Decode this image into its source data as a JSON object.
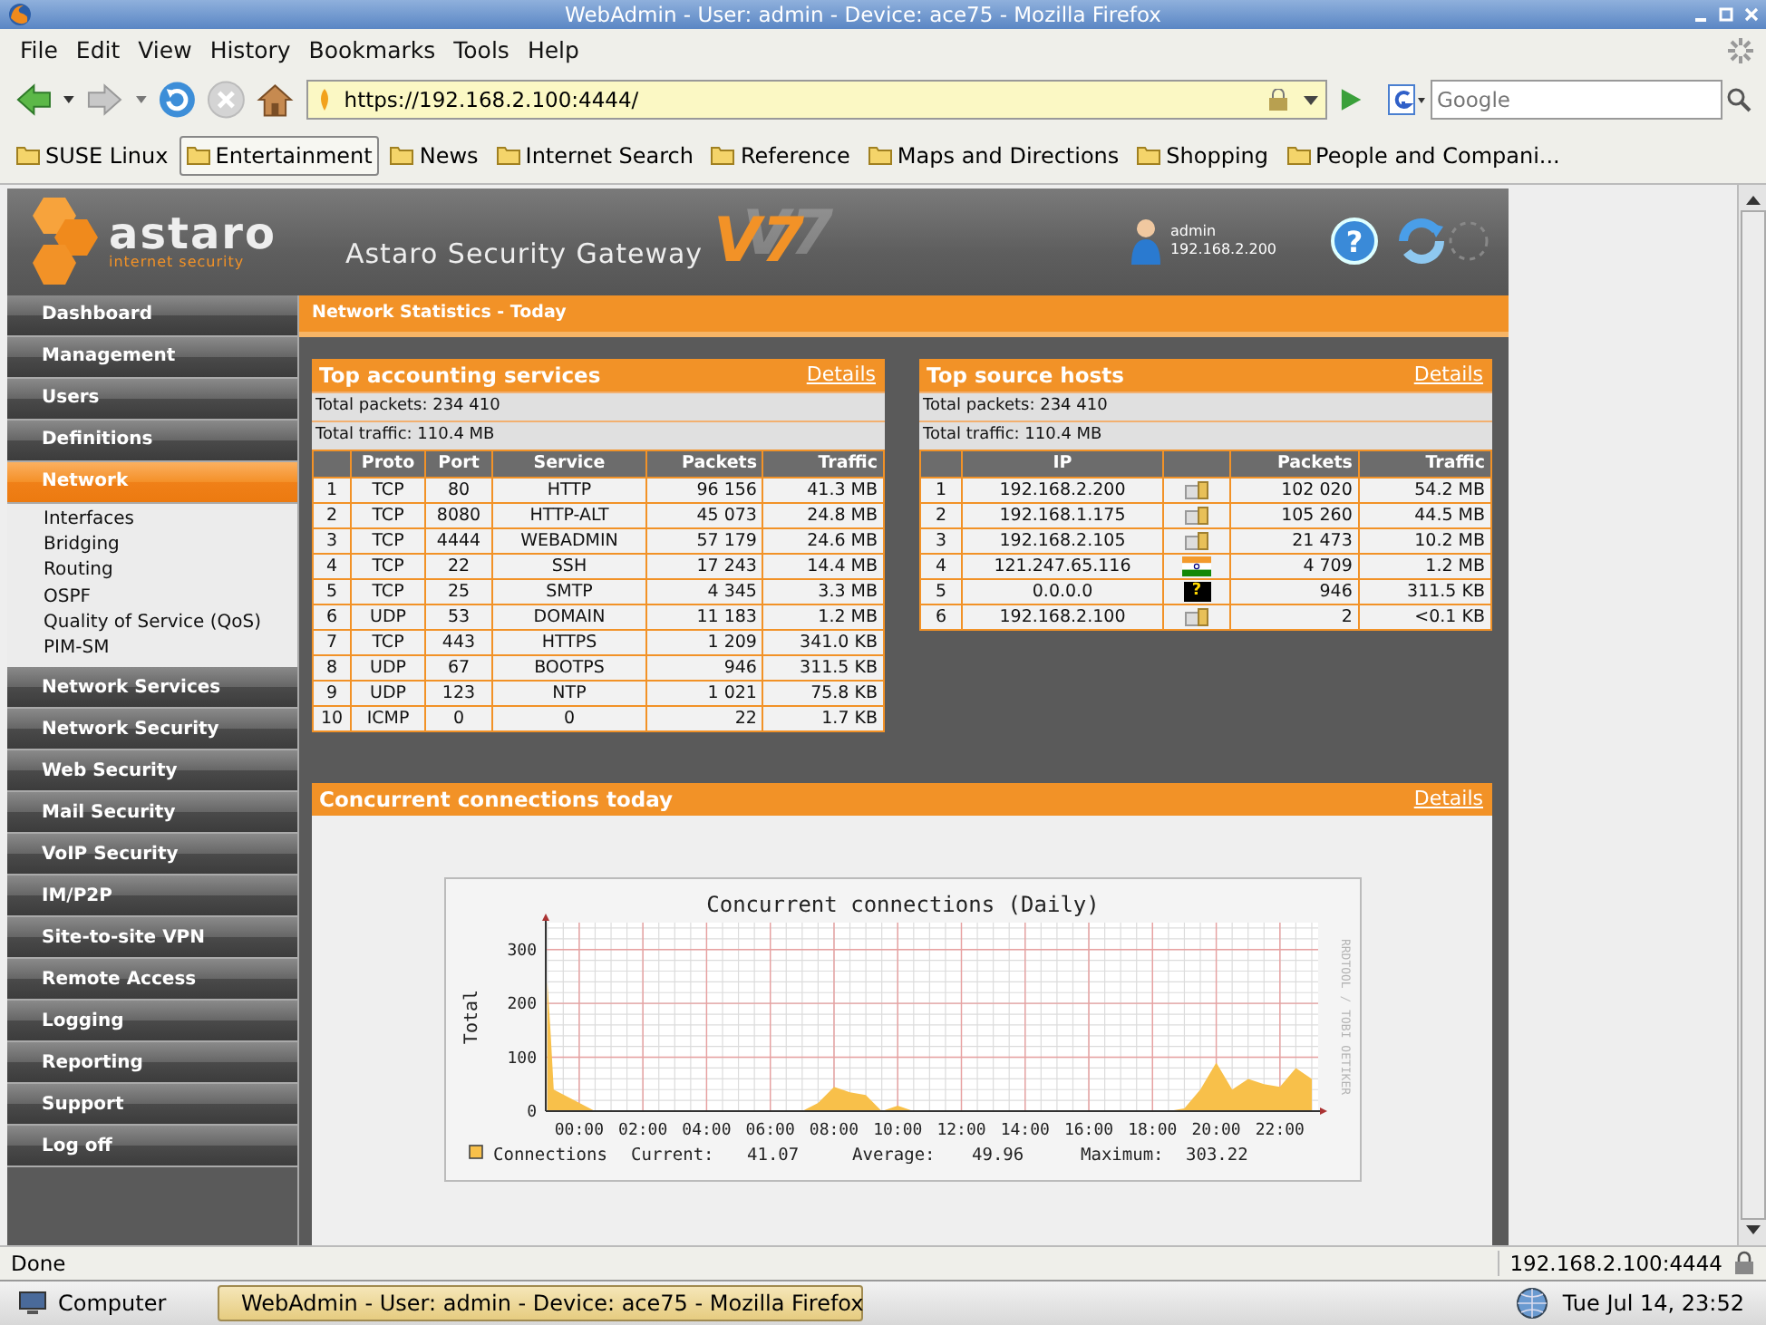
{
  "window": {
    "title": "WebAdmin - User: admin - Device: ace75 - Mozilla Firefox"
  },
  "menu_bar": [
    "File",
    "Edit",
    "View",
    "History",
    "Bookmarks",
    "Tools",
    "Help"
  ],
  "nav": {
    "url": "https://192.168.2.100:4444/",
    "search_placeholder": "Google"
  },
  "bookmarks": [
    {
      "label": "SUSE Linux",
      "selected": false
    },
    {
      "label": "Entertainment",
      "selected": true
    },
    {
      "label": "News",
      "selected": false
    },
    {
      "label": "Internet Search",
      "selected": false
    },
    {
      "label": "Reference",
      "selected": false
    },
    {
      "label": "Maps and Directions",
      "selected": false
    },
    {
      "label": "Shopping",
      "selected": false
    },
    {
      "label": "People and Compani...",
      "selected": false
    }
  ],
  "header": {
    "logo": "astaro",
    "tagline": "internet security",
    "product": "Astaro Security Gateway",
    "version": "V7",
    "user": "admin",
    "ip": "192.168.2.200",
    "help": "?"
  },
  "sidebar": [
    {
      "label": "Dashboard",
      "selected": false
    },
    {
      "label": "Management",
      "selected": false
    },
    {
      "label": "Users",
      "selected": false
    },
    {
      "label": "Definitions",
      "selected": false
    },
    {
      "label": "Network",
      "selected": true,
      "children": [
        {
          "label": "Interfaces"
        },
        {
          "label": "Bridging"
        },
        {
          "label": "Routing"
        },
        {
          "label": "OSPF"
        },
        {
          "label": "Quality of Service (QoS)"
        },
        {
          "label": "PIM-SM"
        }
      ]
    },
    {
      "label": "Network Services",
      "selected": false
    },
    {
      "label": "Network Security",
      "selected": false
    },
    {
      "label": "Web Security",
      "selected": false
    },
    {
      "label": "Mail Security",
      "selected": false
    },
    {
      "label": "VoIP Security",
      "selected": false
    },
    {
      "label": "IM/P2P",
      "selected": false
    },
    {
      "label": "Site-to-site VPN",
      "selected": false
    },
    {
      "label": "Remote Access",
      "selected": false
    },
    {
      "label": "Logging",
      "selected": false
    },
    {
      "label": "Reporting",
      "selected": false
    },
    {
      "label": "Support",
      "selected": false
    },
    {
      "label": "Log off",
      "selected": false
    }
  ],
  "page_title": "Network Statistics - Today",
  "services_panel": {
    "title": "Top accounting services",
    "details": "Details",
    "total_packets": "Total packets: 234 410",
    "total_traffic": "Total traffic: 110.4 MB",
    "columns": [
      "",
      "Proto",
      "Port",
      "Service",
      "Packets",
      "Traffic"
    ],
    "rows": [
      [
        "1",
        "TCP",
        "80",
        "HTTP",
        "96 156",
        "41.3 MB"
      ],
      [
        "2",
        "TCP",
        "8080",
        "HTTP-ALT",
        "45 073",
        "24.8 MB"
      ],
      [
        "3",
        "TCP",
        "4444",
        "WEBADMIN",
        "57 179",
        "24.6 MB"
      ],
      [
        "4",
        "TCP",
        "22",
        "SSH",
        "17 243",
        "14.4 MB"
      ],
      [
        "5",
        "TCP",
        "25",
        "SMTP",
        "4 345",
        "3.3 MB"
      ],
      [
        "6",
        "UDP",
        "53",
        "DOMAIN",
        "11 183",
        "1.2 MB"
      ],
      [
        "7",
        "TCP",
        "443",
        "HTTPS",
        "1 209",
        "341.0 KB"
      ],
      [
        "8",
        "UDP",
        "67",
        "BOOTPS",
        "946",
        "311.5 KB"
      ],
      [
        "9",
        "UDP",
        "123",
        "NTP",
        "1 021",
        "75.8 KB"
      ],
      [
        "10",
        "ICMP",
        "0",
        "0",
        "22",
        "1.7 KB"
      ]
    ]
  },
  "hosts_panel": {
    "title": "Top source hosts",
    "details": "Details",
    "total_packets": "Total packets: 234 410",
    "total_traffic": "Total traffic: 110.4 MB",
    "columns": [
      "",
      "IP",
      "",
      "Packets",
      "Traffic"
    ],
    "rows": [
      {
        "rank": "1",
        "ip": "192.168.2.200",
        "kind": "local",
        "packets": "102 020",
        "traffic": "54.2 MB"
      },
      {
        "rank": "2",
        "ip": "192.168.1.175",
        "kind": "local",
        "packets": "105 260",
        "traffic": "44.5 MB"
      },
      {
        "rank": "3",
        "ip": "192.168.2.105",
        "kind": "local",
        "packets": "21 473",
        "traffic": "10.2 MB"
      },
      {
        "rank": "4",
        "ip": "121.247.65.116",
        "kind": "flag",
        "packets": "4 709",
        "traffic": "1.2 MB"
      },
      {
        "rank": "5",
        "ip": "0.0.0.0",
        "kind": "unknown",
        "glyph": "?",
        "packets": "946",
        "traffic": "311.5 KB"
      },
      {
        "rank": "6",
        "ip": "192.168.2.100",
        "kind": "local",
        "packets": "2",
        "traffic": "<0.1 KB"
      }
    ]
  },
  "connections_panel": {
    "title": "Concurrent connections today",
    "details": "Details",
    "credit": "RRDTOOL / TOBI OETIKER",
    "legend": {
      "current_label": "Current:",
      "current": "41.07",
      "average_label": "Average:",
      "average": "49.96",
      "maximum_label": "Maximum:",
      "maximum": "303.22"
    },
    "chart_data": {
      "type": "area",
      "title": "Concurrent connections (Daily)",
      "ylabel": "Total",
      "x": [
        -1,
        -0.9,
        -0.8,
        0.5,
        1,
        1.5,
        2,
        2.5,
        3,
        3.5,
        4,
        4.5,
        5,
        5.5,
        6,
        6.5,
        7,
        7.5,
        8,
        8.5,
        9,
        9.5,
        10,
        10.5,
        11,
        11.5,
        12,
        12.5,
        13,
        13.5,
        14,
        14.5,
        15,
        15.5,
        16,
        16.5,
        17,
        17.5,
        18,
        18.5,
        19,
        19.5,
        20,
        20.5,
        21,
        21.5,
        22,
        22.5,
        23
      ],
      "series": [
        {
          "name": "Connections",
          "color": "#f8c04a",
          "values": [
            240,
            150,
            40,
            0,
            0,
            0,
            0,
            0,
            0,
            0,
            0,
            0,
            0,
            0,
            0,
            0,
            0,
            15,
            45,
            35,
            30,
            0,
            10,
            0,
            0,
            0,
            0,
            0,
            0,
            0,
            0,
            0,
            0,
            0,
            0,
            0,
            0,
            0,
            0,
            0,
            5,
            40,
            90,
            40,
            60,
            50,
            45,
            80,
            60
          ]
        }
      ],
      "xlim": [
        -1.05,
        23.2
      ],
      "ylim": [
        0,
        350
      ],
      "xticks": [
        {
          "value": 0,
          "label": "00:00"
        },
        {
          "value": 2,
          "label": "02:00"
        },
        {
          "value": 4,
          "label": "04:00"
        },
        {
          "value": 6,
          "label": "06:00"
        },
        {
          "value": 8,
          "label": "08:00"
        },
        {
          "value": 10,
          "label": "10:00"
        },
        {
          "value": 12,
          "label": "12:00"
        },
        {
          "value": 14,
          "label": "14:00"
        },
        {
          "value": 16,
          "label": "16:00"
        },
        {
          "value": 18,
          "label": "18:00"
        },
        {
          "value": 20,
          "label": "20:00"
        },
        {
          "value": 22,
          "label": "22:00"
        }
      ],
      "yticks": [
        0,
        100,
        200,
        300
      ],
      "grid": true
    }
  },
  "status_bar": {
    "text": "Done",
    "host": "192.168.2.100:4444"
  },
  "taskbar": {
    "start": "Computer",
    "task": "WebAdmin - User: admin - Device: ace75 - Mozilla Firefox",
    "clock": "Tue Jul 14, 23:52"
  }
}
